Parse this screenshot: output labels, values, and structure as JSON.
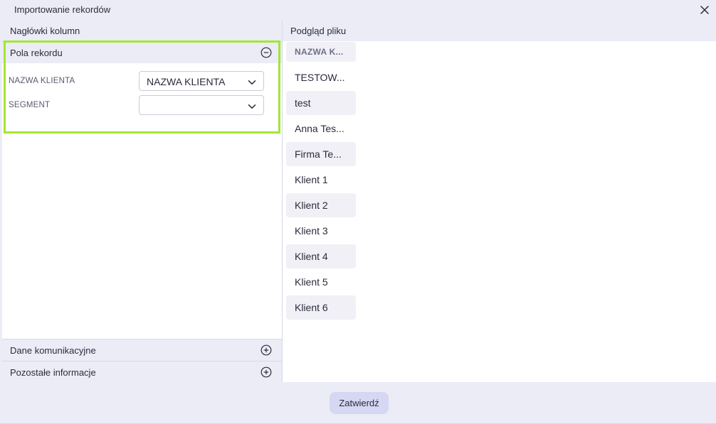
{
  "dialog": {
    "title": "Importowanie rekordów",
    "close_icon": "close-icon"
  },
  "left": {
    "header": "Nagłówki kolumn",
    "sections": [
      {
        "label": "Pola rekordu",
        "state": "expanded",
        "icon": "minus-circle-icon"
      },
      {
        "label": "Dane komunikacyjne",
        "state": "collapsed",
        "icon": "plus-circle-icon"
      },
      {
        "label": "Pozostałe informacje",
        "state": "collapsed",
        "icon": "plus-circle-icon"
      }
    ],
    "fields": [
      {
        "label": "NAZWA KLIENTA",
        "value": "NAZWA KLIENTA"
      },
      {
        "label": "SEGMENT",
        "value": ""
      }
    ]
  },
  "right": {
    "header": "Podgląd pliku",
    "column": [
      "NAZWA K...",
      "TESTOW...",
      "test",
      "Anna Tes...",
      "Firma Te...",
      "Klient 1",
      "Klient 2",
      "Klient 3",
      "Klient 4",
      "Klient 5",
      "Klient 6"
    ]
  },
  "footer": {
    "confirm_label": "Zatwierdź"
  },
  "colors": {
    "highlight": "#a3e635",
    "panel_bg": "#ebecf6",
    "button_bg": "#d5d7f3"
  }
}
